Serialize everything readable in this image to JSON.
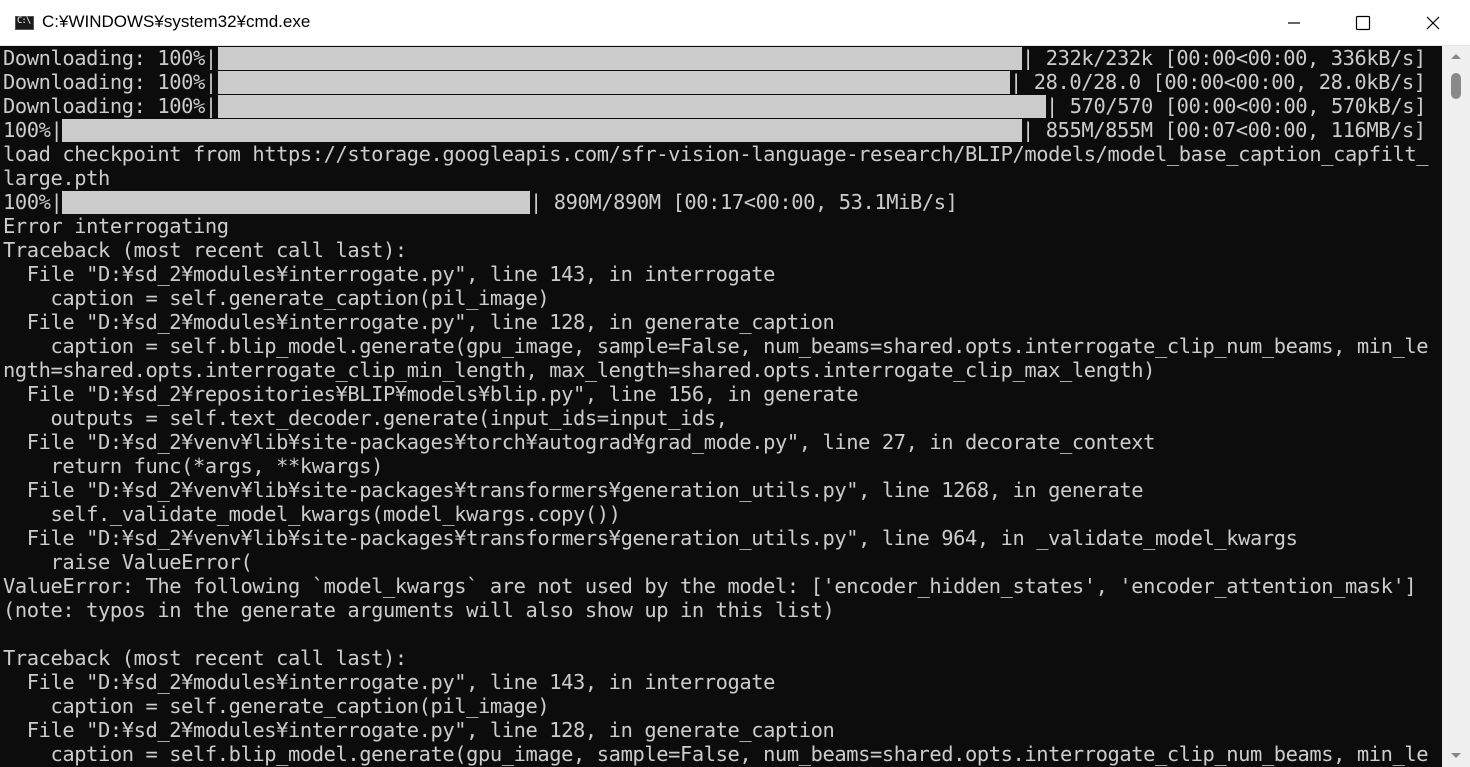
{
  "window": {
    "title": "C:¥WINDOWS¥system32¥cmd.exe",
    "icon": "cmd-console-icon",
    "icon_glyph": "C:\\",
    "controls": [
      "minimize-icon",
      "maximize-icon",
      "close-icon"
    ]
  },
  "progress_bars": [
    {
      "prefix": "Downloading: 100%|",
      "stats": "| 232k/232k [00:00<00:00, 336kB/s]",
      "progress": 1.0
    },
    {
      "prefix": "Downloading: 100%|",
      "stats": "| 28.0/28.0 [00:00<00:00, 28.0kB/s]",
      "progress": 1.0
    },
    {
      "prefix": "Downloading: 100%|",
      "stats": "| 570/570 [00:00<00:00, 570kB/s]",
      "progress": 1.0
    },
    {
      "prefix": "100%|",
      "stats": "| 855M/855M [00:07<00:00, 116MB/s]",
      "progress": 1.0
    }
  ],
  "checkpoint_lines": [
    "load checkpoint from https://storage.googleapis.com/sfr-vision-language-research/BLIP/models/model_base_caption_capfilt_",
    "large.pth"
  ],
  "checkpoint_bar": {
    "prefix": "100%|",
    "stats": "| 890M/890M [00:17<00:00, 53.1MiB/s]",
    "progress": 1.0
  },
  "output_lines": [
    "Error interrogating",
    "Traceback (most recent call last):",
    "  File \"D:¥sd_2¥modules¥interrogate.py\", line 143, in interrogate",
    "    caption = self.generate_caption(pil_image)",
    "  File \"D:¥sd_2¥modules¥interrogate.py\", line 128, in generate_caption",
    "    caption = self.blip_model.generate(gpu_image, sample=False, num_beams=shared.opts.interrogate_clip_num_beams, min_le",
    "ngth=shared.opts.interrogate_clip_min_length, max_length=shared.opts.interrogate_clip_max_length)",
    "  File \"D:¥sd_2¥repositories¥BLIP¥models¥blip.py\", line 156, in generate",
    "    outputs = self.text_decoder.generate(input_ids=input_ids,",
    "  File \"D:¥sd_2¥venv¥lib¥site-packages¥torch¥autograd¥grad_mode.py\", line 27, in decorate_context",
    "    return func(*args, **kwargs)",
    "  File \"D:¥sd_2¥venv¥lib¥site-packages¥transformers¥generation_utils.py\", line 1268, in generate",
    "    self._validate_model_kwargs(model_kwargs.copy())",
    "  File \"D:¥sd_2¥venv¥lib¥site-packages¥transformers¥generation_utils.py\", line 964, in _validate_model_kwargs",
    "    raise ValueError(",
    "ValueError: The following `model_kwargs` are not used by the model: ['encoder_hidden_states', 'encoder_attention_mask']",
    "(note: typos in the generate arguments will also show up in this list)",
    "",
    "Traceback (most recent call last):",
    "  File \"D:¥sd_2¥modules¥interrogate.py\", line 143, in interrogate",
    "    caption = self.generate_caption(pil_image)",
    "  File \"D:¥sd_2¥modules¥interrogate.py\", line 128, in generate_caption",
    "    caption = self.blip_model.generate(gpu_image, sample=False, num_beams=shared.opts.interrogate_clip_num_beams, min_le"
  ],
  "colors": {
    "console_bg": "#0c0c0c",
    "console_text": "#cccccc",
    "titlebar_bg": "#ffffff",
    "scrollbar_bg": "#f0f0f0"
  }
}
